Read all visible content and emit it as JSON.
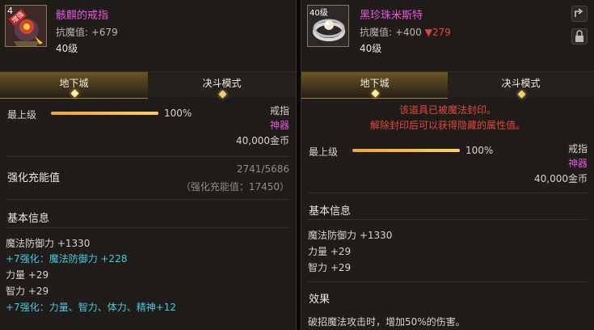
{
  "left_item": {
    "name": "骸麒的戒指",
    "stat_label": "抗魔值: +679",
    "level": "40级",
    "badge_number": "4",
    "badge_text": "增强",
    "tabs": [
      {
        "label": "地下城"
      },
      {
        "label": "决斗模式"
      }
    ],
    "top_level_label": "最上级",
    "top_level_percent": "100%",
    "top_level_fraction": 1.0,
    "type_label": "戒指",
    "rarity_label": "神器",
    "price": "40,000金币",
    "amplify_label": "强化充能值",
    "amplify_value": "2741/5686",
    "amplify_note": "（强化充能值：17450）",
    "basic_info_title": "基本信息",
    "stats": [
      "魔法防御力 +1330",
      "+7强化：魔法防御力 +228",
      "力量 +29",
      "智力 +29",
      "+7强化：力量、智力、体力、精神+12"
    ]
  },
  "right_item": {
    "name": "黑珍珠米斯特",
    "stat_prefix": "抗魔值: +400",
    "stat_diff": "▼279",
    "level": "40级",
    "icon_level": "40级",
    "tabs": [
      {
        "label": "地下城"
      },
      {
        "label": "决斗模式"
      }
    ],
    "seal_notice_1": "该道具已被魔法封印。",
    "seal_notice_2": "解除封印后可以获得隐藏的属性值。",
    "top_level_label": "最上级",
    "top_level_percent": "100%",
    "top_level_fraction": 1.0,
    "type_label": "戒指",
    "rarity_label": "神器",
    "price": "40,000金币",
    "basic_info_title": "基本信息",
    "stats": [
      "魔法防御力 +1330",
      "力量 +29",
      "智力 +29"
    ],
    "effect_title": "效果",
    "effect_text": "破招魔法攻击时，增加50%的伤害。"
  },
  "side_icons": [
    "share-icon",
    "lock-icon"
  ],
  "colors": {
    "rarity": "#e05ad8",
    "enhance": "#47c9d8",
    "decrease": "#e0463e",
    "bar": "#ffcf63"
  }
}
